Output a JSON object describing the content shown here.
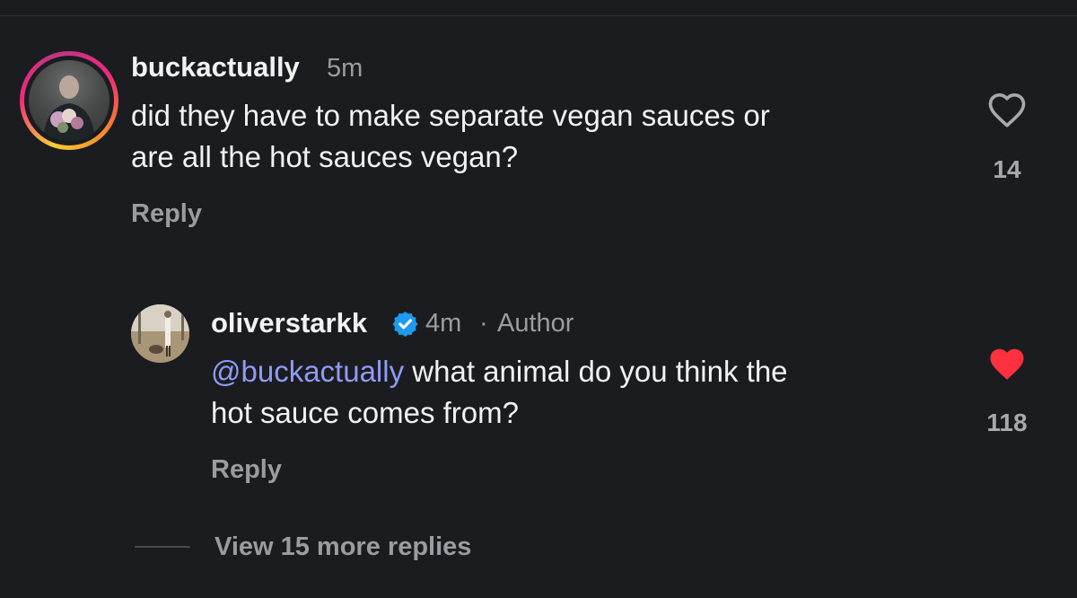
{
  "comment": {
    "username": "buckactually",
    "time": "5m",
    "text_line1": "did they have to make separate vegan sauces or",
    "text_line2": "are all the hot sauces vegan?",
    "reply_label": "Reply",
    "likes": "14",
    "liked": false,
    "avatar_ring": "story-gradient"
  },
  "reply": {
    "username": "oliverstarkk",
    "verified": true,
    "time": "4m",
    "separator": "·",
    "author_label": "Author",
    "mention": "@buckactually",
    "text_line1_rest": " what animal do you think the",
    "text_line2": "hot sauce comes from?",
    "reply_label": "Reply",
    "likes": "118",
    "liked": true
  },
  "view_more": {
    "label": "View 15 more replies"
  },
  "colors": {
    "background": "#1b1c20",
    "text": "#f2f2f2",
    "muted": "#9a9ca1",
    "mention": "#8f9bf5",
    "liked_heart": "#ff3040",
    "verified": "#1d9bf0"
  },
  "icons": {
    "like_outline": "heart-outline-icon",
    "like_filled": "heart-filled-icon",
    "verified": "verified-badge-icon"
  }
}
